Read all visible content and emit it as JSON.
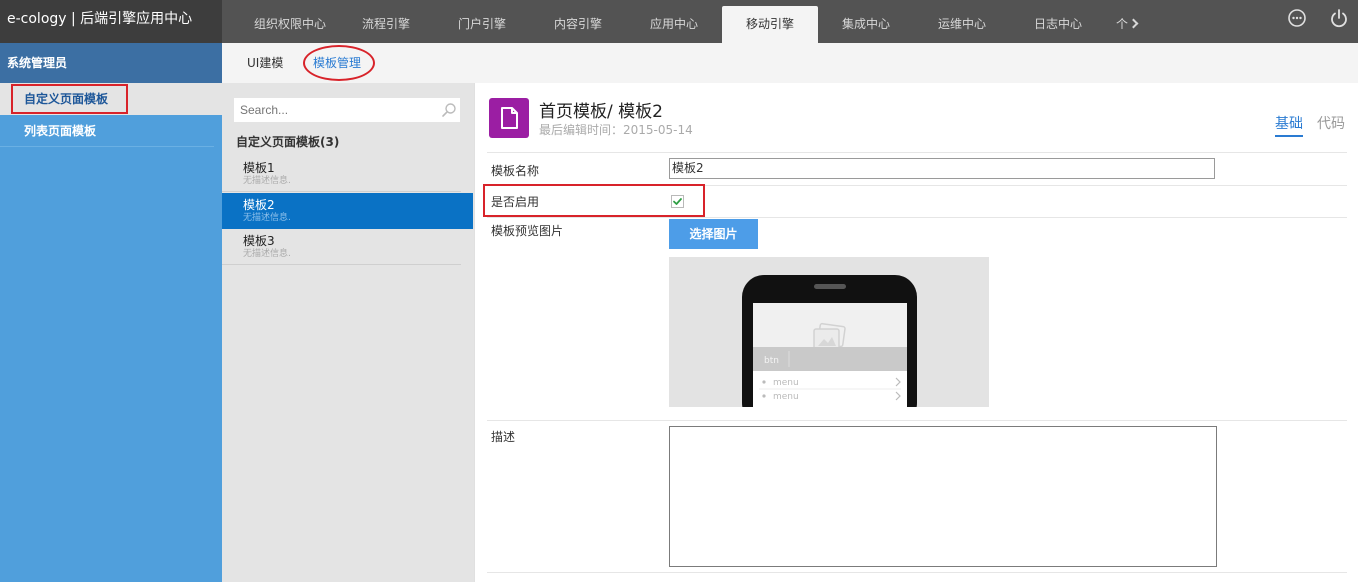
{
  "app": {
    "title": "e-cology | 后端引擎应用中心"
  },
  "nav": {
    "items": [
      "组织权限中心",
      "流程引擎",
      "门户引擎",
      "内容引擎",
      "应用中心",
      "移动引擎",
      "集成中心",
      "运维中心",
      "日志中心"
    ],
    "active_index": 5,
    "more_label": "个"
  },
  "sidebar": {
    "header": "系统管理员",
    "items": [
      {
        "label": "自定义页面模板",
        "active": true
      },
      {
        "label": "列表页面模板",
        "active": false
      }
    ]
  },
  "subtabs": {
    "items": [
      "UI建模",
      "模板管理"
    ],
    "active_index": 1
  },
  "list": {
    "search_placeholder": "Search...",
    "title": "自定义页面模板(3)",
    "items": [
      {
        "name": "模板1",
        "desc": "无描述信息."
      },
      {
        "name": "模板2",
        "desc": "无描述信息."
      },
      {
        "name": "模板3",
        "desc": "无描述信息."
      }
    ],
    "active_index": 1
  },
  "detail": {
    "title": "首页模板/ 模板2",
    "subtitle": "最后编辑时间：2015-05-14",
    "tabs": [
      "基础",
      "代码"
    ],
    "form": {
      "name_label": "模板名称",
      "name_value": "模板2",
      "enabled_label": "是否启用",
      "enabled": true,
      "preview_label": "模板预览图片",
      "select_image_label": "选择图片",
      "desc_label": "描述",
      "desc_value": ""
    },
    "preview": {
      "btn_label": "btn",
      "menu_items": [
        "menu",
        "menu"
      ]
    }
  },
  "colors": {
    "accent": "#2a7bd2",
    "sidebar": "#509fdc",
    "selected_row": "#0a72c5",
    "annotation": "#d8232a",
    "doc_icon": "#9b1ea3"
  }
}
